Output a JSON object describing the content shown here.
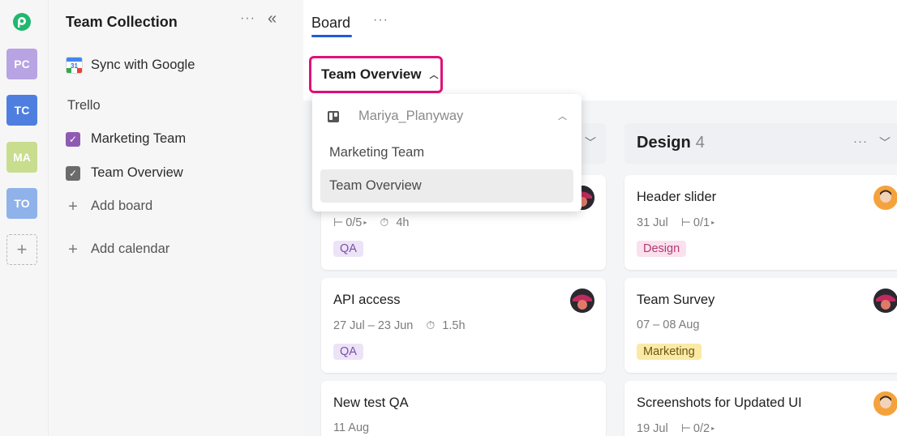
{
  "rail": {
    "workspaces": [
      {
        "initials": "PC",
        "color": "#b8a3e3"
      },
      {
        "initials": "TC",
        "color": "#4e7fe0"
      },
      {
        "initials": "MA",
        "color": "#c8dd8e"
      },
      {
        "initials": "TO",
        "color": "#8fb2ea"
      }
    ],
    "add": "+"
  },
  "sidebar": {
    "title": "Team Collection",
    "more": "···",
    "collapse": "«",
    "sync": {
      "label": "Sync with Google",
      "cal_number": "31"
    },
    "section": "Trello",
    "boards": [
      {
        "label": "Marketing Team",
        "color": "#8f5bb2",
        "checked": true
      },
      {
        "label": "Team Overview",
        "color": "#6b6b6b",
        "checked": true
      }
    ],
    "add_board": "Add board",
    "add_calendar": "Add calendar"
  },
  "main": {
    "tab": "Board",
    "tab_more": "···",
    "selector": {
      "label": "Team Overview",
      "chevron": "^"
    }
  },
  "dropdown": {
    "header": "Mariya_Planyway",
    "items": [
      "Marketing Team",
      "Team Overview"
    ],
    "selected": "Team Overview"
  },
  "columns": [
    {
      "title": "",
      "count": "",
      "cards": [
        {
          "title": "",
          "meta": [
            {
              "icon": "subtask-icon",
              "text": "0/5"
            },
            {
              "icon": "timer-icon",
              "text": "4h"
            }
          ],
          "tag": {
            "text": "QA",
            "bg": "#ede3f7",
            "fg": "#7a4fa6"
          }
        },
        {
          "title": "API access",
          "meta": [
            {
              "icon": "",
              "text": "27 Jul – 23 Jun"
            },
            {
              "icon": "timer-icon",
              "text": "1.5h"
            }
          ],
          "tag": {
            "text": "QA",
            "bg": "#ede3f7",
            "fg": "#7a4fa6"
          }
        },
        {
          "title": "New test QA",
          "meta": [
            {
              "icon": "",
              "text": "11 Aug"
            }
          ],
          "tag": null
        }
      ]
    },
    {
      "title": "Design",
      "count": "4",
      "cards": [
        {
          "title": "Header slider",
          "meta": [
            {
              "icon": "",
              "text": "31 Jul"
            },
            {
              "icon": "subtask-icon",
              "text": "0/1"
            }
          ],
          "tag": {
            "text": "Design",
            "bg": "#fbe1ee",
            "fg": "#b03a71"
          }
        },
        {
          "title": "Team Survey",
          "meta": [
            {
              "icon": "",
              "text": "07 – 08 Aug"
            }
          ],
          "tag": {
            "text": "Marketing",
            "bg": "#fbeaa6",
            "fg": "#6b5610"
          }
        },
        {
          "title": "Screenshots for Updated UI",
          "meta": [
            {
              "icon": "",
              "text": "19 Jul"
            },
            {
              "icon": "subtask-icon",
              "text": "0/2"
            }
          ],
          "tag": null
        }
      ]
    }
  ],
  "colors": {
    "accent": "#1e5bd6",
    "highlight": "#e0127a",
    "brand": "#1fb86e"
  }
}
